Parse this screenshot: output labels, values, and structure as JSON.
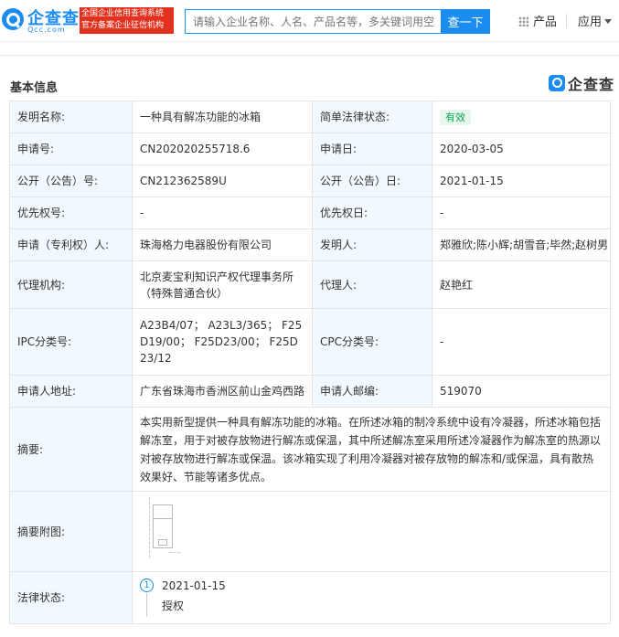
{
  "header": {
    "logo_cn": "企查查",
    "logo_en": "Qcc.com",
    "slogan_line1": "全国企业信用查询系统",
    "slogan_line2": "官方备案企业征信机构",
    "search_placeholder": "请输入企业名称、人名、产品名等，多关键词用空",
    "search_button": "查一下",
    "nav_products": "产品",
    "nav_apps": "应用"
  },
  "section": {
    "title": "基本信息",
    "watermark": "企查查"
  },
  "rows": {
    "invention_name_label": "发明名称:",
    "invention_name": "一种具有解冻功能的冰箱",
    "legal_status_label": "简单法律状态:",
    "legal_status": "有效",
    "app_no_label": "申请号:",
    "app_no": "CN202020255718.6",
    "app_date_label": "申请日:",
    "app_date": "2020-03-05",
    "pub_no_label": "公开（公告）号:",
    "pub_no": "CN212362589U",
    "pub_date_label": "公开（公告）日:",
    "pub_date": "2021-01-15",
    "priority_no_label": "优先权号:",
    "priority_no": "-",
    "priority_date_label": "优先权日:",
    "priority_date": "-",
    "applicant_label": "申请（专利权）人:",
    "applicant": "珠海格力电器股份有限公司",
    "inventor_label": "发明人:",
    "inventor": "郑雅欣;陈小辉;胡雪音;毕然;赵树男",
    "agency_label": "代理机构:",
    "agency_line1": "北京麦宝利知识产权代理事务所",
    "agency_line2": "（特殊普通合伙）",
    "agent_label": "代理人:",
    "agent": "赵艳红",
    "ipc_label": "IPC分类号:",
    "ipc_line1": "A23B4/07；  A23L3/365；  F25",
    "ipc_line2": "D19/00；  F25D23/00；  F25D",
    "ipc_line3": "23/12",
    "cpc_label": "CPC分类号:",
    "cpc": "-",
    "address_label": "申请人地址:",
    "address": "广东省珠海市香洲区前山金鸡西路",
    "postcode_label": "申请人邮编:",
    "postcode": "519070",
    "abstract_label": "摘要:",
    "abstract_line1": "本实用新型提供一种具有解冻功能的冰箱。在所述冰箱的制冷系统中设有冷凝器，所述冰箱包括",
    "abstract_line2": "解冻室，用于对被存放物进行解冻或保温，其中所述解冻室采用所述冷凝器作为解冻室的热源以",
    "abstract_line3": "对被存放物进行解冻或保温。该冰箱实现了利用冷凝器对被存放物的解冻和/或保温，具有散热",
    "abstract_line4": "效果好、节能等诸多优点。",
    "abstract_image_label": "摘要附图:",
    "legal_label": "法律状态:",
    "legal_index": "1",
    "legal_date": "2021-01-15",
    "legal_event": "授权"
  }
}
